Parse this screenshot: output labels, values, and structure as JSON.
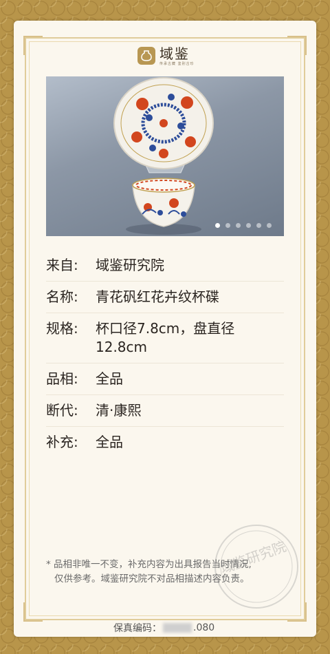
{
  "brand": {
    "name": "域鉴",
    "tagline": "传承古藏 鉴别古珍"
  },
  "gallery": {
    "total": 6,
    "active_index": 0
  },
  "details": [
    {
      "label": "来自:",
      "value": "域鉴研究院"
    },
    {
      "label": "名称:",
      "value": "青花矾红花卉纹杯碟"
    },
    {
      "label": "规格:",
      "value": "杯口径7.8cm，盘直径12.8cm"
    },
    {
      "label": "品相:",
      "value": "全品"
    },
    {
      "label": "断代:",
      "value": "清·康熙"
    },
    {
      "label": "补充:",
      "value": "全品"
    }
  ],
  "note": {
    "line1": "* 品相非唯一不变，补充内容为出具报告当时情况,",
    "line2": "仅供参考。域鉴研究院不对品相描述内容负责。"
  },
  "certificate": {
    "label": "保真编码：",
    "code_suffix": ".080"
  },
  "seal_text": "域鉴研究院",
  "colors": {
    "border_gold": "#b8954a",
    "card": "#fbf7ee",
    "logo_gold": "#b89752"
  }
}
